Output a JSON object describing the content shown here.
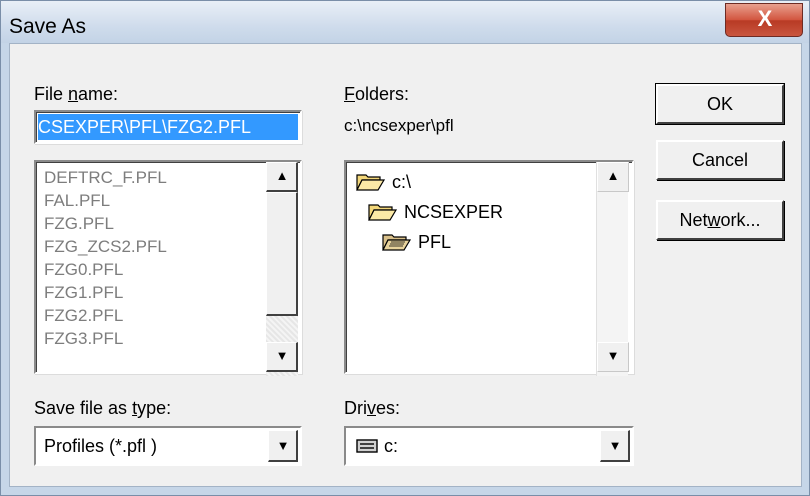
{
  "window": {
    "title": "Save As",
    "close_glyph": "X"
  },
  "file_name": {
    "label_pre": "File ",
    "label_accel": "n",
    "label_post": "ame:",
    "value": "CSEXPER\\PFL\\FZG2.PFL",
    "files": [
      "DEFTRC_F.PFL",
      "FAL.PFL",
      "FZG.PFL",
      "FZG_ZCS2.PFL",
      "FZG0.PFL",
      "FZG1.PFL",
      "FZG2.PFL",
      "FZG3.PFL"
    ]
  },
  "folders": {
    "label_accel": "F",
    "label_post": "olders:",
    "current_path": "c:\\ncsexper\\pfl",
    "items": [
      "c:\\",
      "NCSEXPER",
      "PFL"
    ]
  },
  "save_type": {
    "label_pre": "Save file as ",
    "label_accel": "t",
    "label_post": "ype:",
    "value": "Profiles (*.pfl )"
  },
  "drives": {
    "label_pre": "Dri",
    "label_accel": "v",
    "label_post": "es:",
    "value": "c:"
  },
  "buttons": {
    "ok": "OK",
    "cancel": "Cancel",
    "network_pre": "Net",
    "network_accel": "w",
    "network_post": "ork..."
  },
  "icons": {
    "scroll_up": "▲",
    "scroll_down": "▼",
    "dropdown": "▼"
  },
  "colors": {
    "selection": "#3399ff",
    "close_button": "#c9563f",
    "title_bar": "#cfdcec"
  }
}
